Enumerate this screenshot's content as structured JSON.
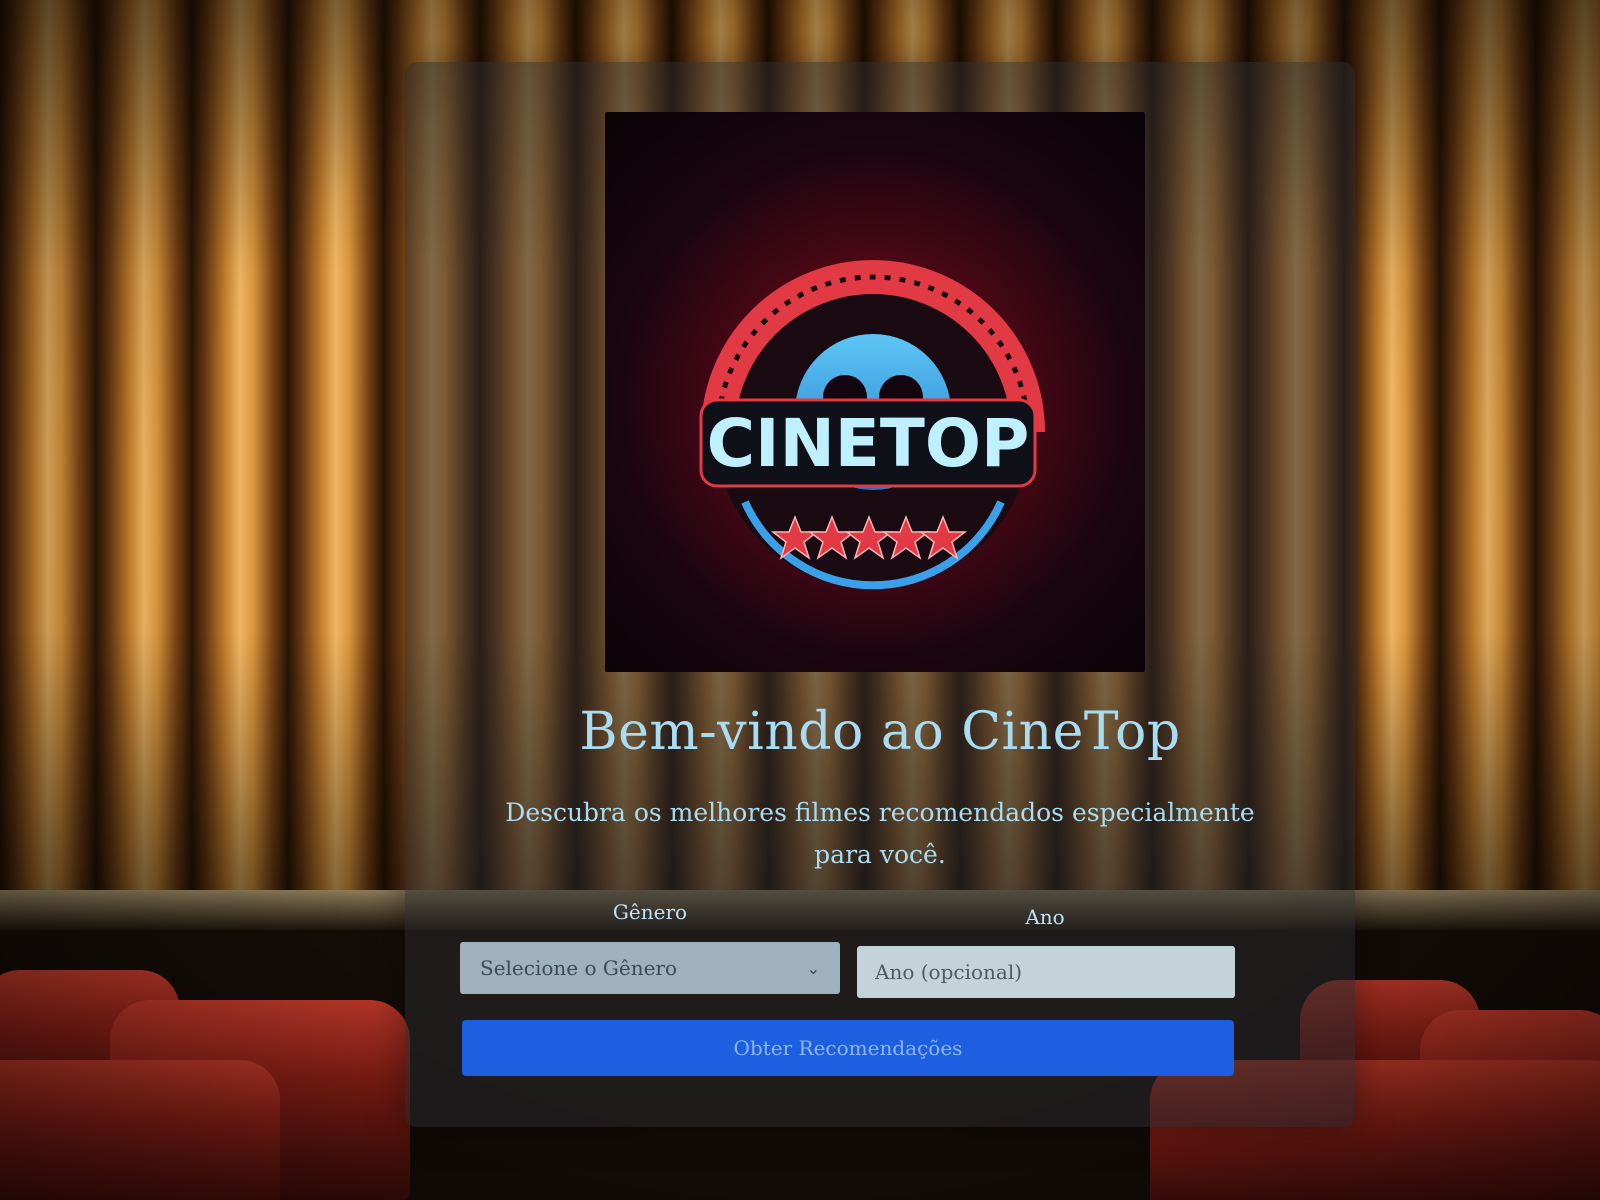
{
  "logo": {
    "text": "CINETOP",
    "stars": 5
  },
  "hero": {
    "title": "Bem-vindo ao CineTop",
    "subtitle": "Descubra os melhores filmes recomendados especialmente para você."
  },
  "form": {
    "genre_label": "Gênero",
    "genre_selected": "Selecione o Gênero",
    "year_label": "Ano",
    "year_placeholder": "Ano (opcional)",
    "submit_label": "Obter Recomendações"
  },
  "colors": {
    "accent": "#1d5fe0",
    "title_text": "#a8dcf2",
    "logo_red": "#e23a45",
    "logo_blue": "#3aa0e8"
  }
}
